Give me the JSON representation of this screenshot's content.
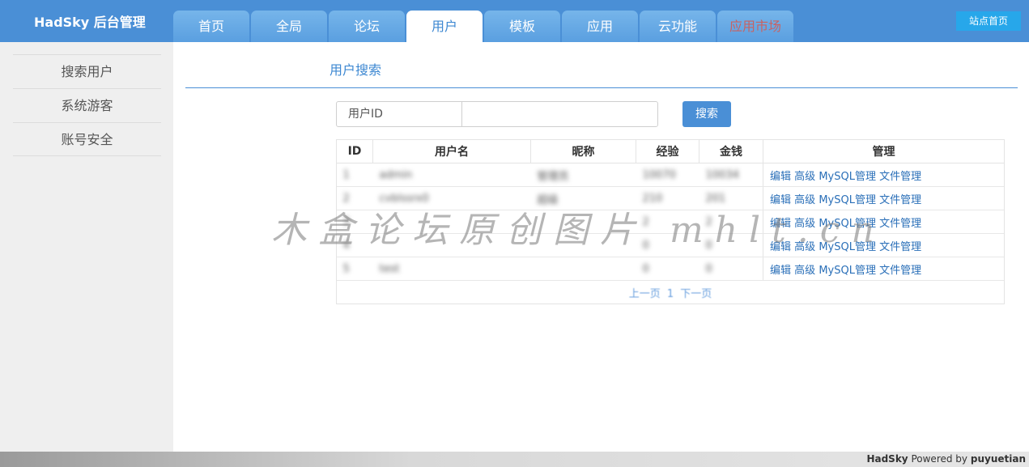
{
  "header": {
    "brand": "HadSky 后台管理",
    "tabs": [
      {
        "label": "首页"
      },
      {
        "label": "全局"
      },
      {
        "label": "论坛"
      },
      {
        "label": "用户"
      },
      {
        "label": "模板"
      },
      {
        "label": "应用"
      },
      {
        "label": "云功能"
      },
      {
        "label": "应用市场"
      }
    ],
    "active_tab": "用户",
    "site_home": "站点首页"
  },
  "sidebar": {
    "items": [
      {
        "label": "搜索用户"
      },
      {
        "label": "系统游客"
      },
      {
        "label": "账号安全"
      }
    ]
  },
  "main": {
    "section_title": "用户搜索",
    "search": {
      "label": "用户ID",
      "value": "",
      "placeholder": "",
      "button": "搜索"
    },
    "table": {
      "columns": [
        "ID",
        "用户名",
        "昵称",
        "经验",
        "金钱",
        "管理"
      ],
      "rows": [
        {
          "id": "1",
          "username": "admin",
          "nickname": "管理员",
          "exp": "10070",
          "money": "10034"
        },
        {
          "id": "2",
          "username": "cvblssrx0",
          "nickname": "超级",
          "exp": "210",
          "money": "201"
        },
        {
          "id": "3",
          "username": "",
          "nickname": "",
          "exp": "2",
          "money": "2"
        },
        {
          "id": "4",
          "username": "",
          "nickname": "",
          "exp": "0",
          "money": "0"
        },
        {
          "id": "5",
          "username": "test",
          "nickname": "",
          "exp": "0",
          "money": "0"
        }
      ],
      "actions": {
        "edit": "编辑",
        "advanced": "高级",
        "mysql": "MySQL管理",
        "files": "文件管理"
      },
      "pager": {
        "prev": "上一页",
        "page": "1",
        "next": "下一页"
      }
    }
  },
  "watermark": "木盒论坛原创图片 mhlt.cn",
  "footer": {
    "brand": "HadSky",
    "powered_by": "Powered by",
    "author": "puyuetian"
  },
  "colors": {
    "header": "#4a8fd6",
    "accent": "#3e88d2",
    "button": "#4a8fd6",
    "site_home": "#27a7ea",
    "market": "#c86262",
    "sidebar": "#efefef"
  }
}
